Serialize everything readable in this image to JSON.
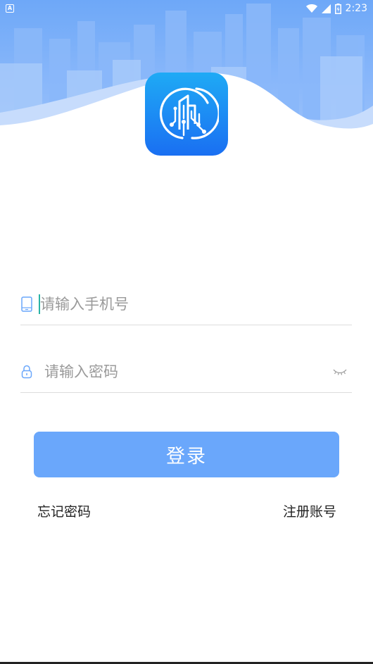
{
  "status_bar": {
    "notification_icon": "A",
    "time": "2:23",
    "icons": [
      "wifi-icon",
      "cellular-signal-icon",
      "battery-charging-icon"
    ]
  },
  "logo": {
    "icon": "smart-city-building-icon"
  },
  "login_form": {
    "phone_placeholder": "请输入手机号",
    "phone_value": "",
    "password_placeholder": "请输入密码",
    "password_value": "",
    "login_label": "登录"
  },
  "links": {
    "forgot_password": "忘记密码",
    "register": "注册账号"
  },
  "colors": {
    "header_light": "#d6e6fd",
    "header_mid": "#a7c9fb",
    "header_dark": "#7fb0f8",
    "accent": "#6aa7fb",
    "logo_top": "#1faaf5",
    "logo_bottom": "#1a6ff2"
  }
}
